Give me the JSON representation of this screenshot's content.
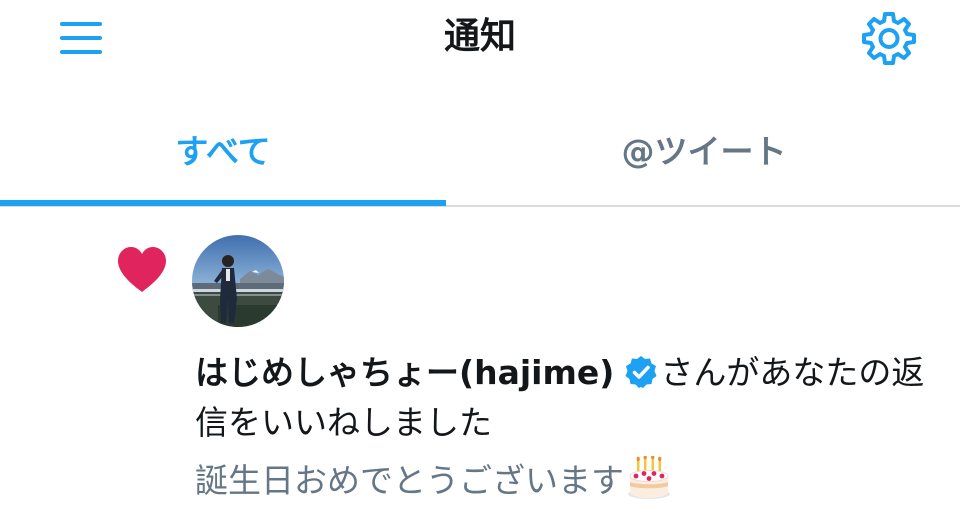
{
  "header": {
    "title": "通知",
    "menu_icon": "hamburger-menu-icon",
    "settings_icon": "gear-icon",
    "accent_color": "#1da1f2"
  },
  "tabs": [
    {
      "label": "すべて",
      "active": true
    },
    {
      "label": "@ツイート",
      "active": false
    }
  ],
  "notification": {
    "type_icon": "heart-icon",
    "heart_color": "#e0245e",
    "avatar": "user-avatar",
    "user_name": "はじめしゃちょー(hajime)",
    "verified": true,
    "verified_icon": "verified-badge-icon",
    "action_text": "さんがあなたの返信をいいねしました",
    "tweet_text": "誕生日おめでとうございます",
    "tweet_emoji": "birthday-cake-icon"
  }
}
